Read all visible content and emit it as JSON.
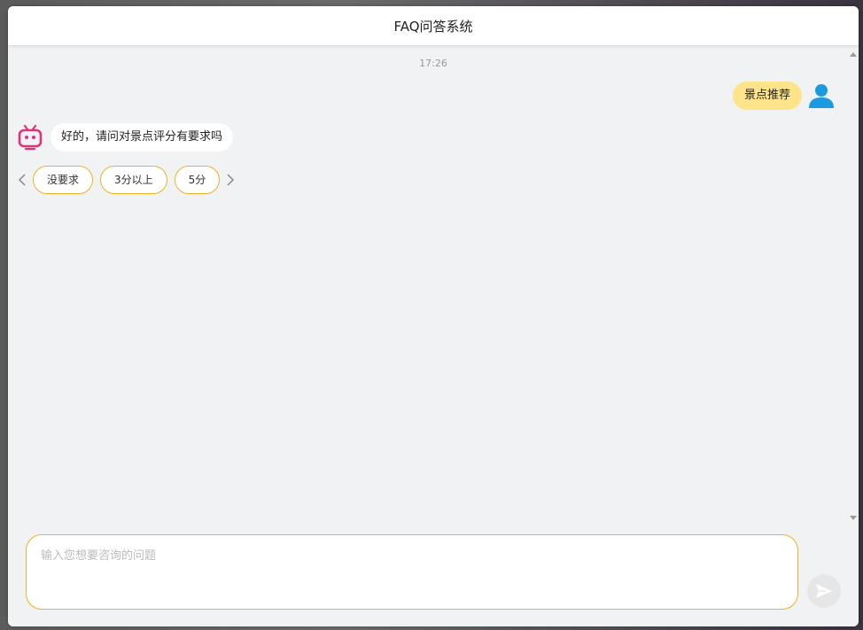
{
  "header": {
    "title": "FAQ问答系统"
  },
  "chat": {
    "timestamp": "17:26",
    "user_message": "景点推荐",
    "bot_message": "好的，请问对景点评分有要求吗",
    "options": [
      "没要求",
      "3分以上",
      "5分"
    ]
  },
  "input": {
    "placeholder": "输入您想要咨询的问题",
    "value": ""
  },
  "icons": {
    "user_avatar": "user-icon",
    "bot_avatar": "robot-icon",
    "prev": "chevron-left-icon",
    "next": "chevron-right-icon",
    "send": "send-icon"
  },
  "colors": {
    "accent": "#f2b122",
    "user_bubble": "#fde38a",
    "user_icon": "#1a9be0",
    "bot_icon": "#e0337a"
  }
}
